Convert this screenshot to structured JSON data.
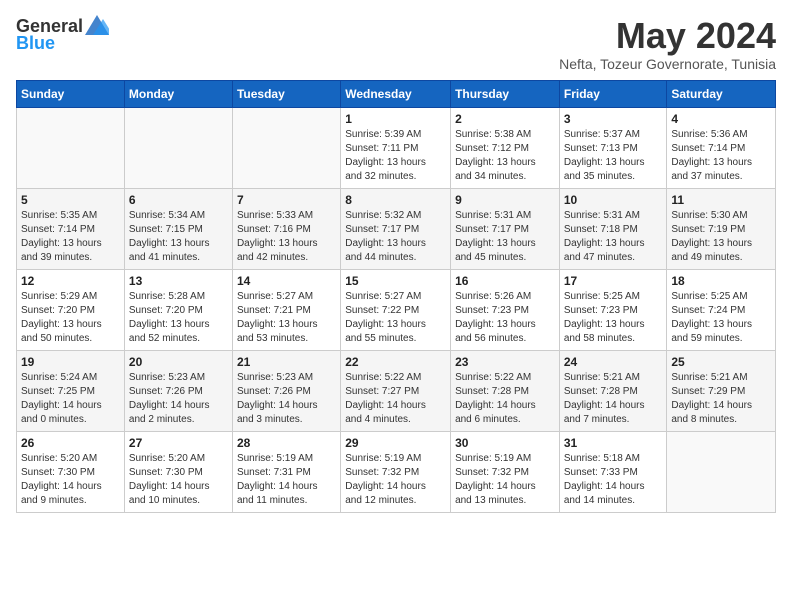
{
  "logo": {
    "general": "General",
    "blue": "Blue"
  },
  "title": {
    "month": "May 2024",
    "location": "Nefta, Tozeur Governorate, Tunisia"
  },
  "weekdays": [
    "Sunday",
    "Monday",
    "Tuesday",
    "Wednesday",
    "Thursday",
    "Friday",
    "Saturday"
  ],
  "weeks": [
    [
      {
        "day": "",
        "info": ""
      },
      {
        "day": "",
        "info": ""
      },
      {
        "day": "",
        "info": ""
      },
      {
        "day": "1",
        "info": "Sunrise: 5:39 AM\nSunset: 7:11 PM\nDaylight: 13 hours\nand 32 minutes."
      },
      {
        "day": "2",
        "info": "Sunrise: 5:38 AM\nSunset: 7:12 PM\nDaylight: 13 hours\nand 34 minutes."
      },
      {
        "day": "3",
        "info": "Sunrise: 5:37 AM\nSunset: 7:13 PM\nDaylight: 13 hours\nand 35 minutes."
      },
      {
        "day": "4",
        "info": "Sunrise: 5:36 AM\nSunset: 7:14 PM\nDaylight: 13 hours\nand 37 minutes."
      }
    ],
    [
      {
        "day": "5",
        "info": "Sunrise: 5:35 AM\nSunset: 7:14 PM\nDaylight: 13 hours\nand 39 minutes."
      },
      {
        "day": "6",
        "info": "Sunrise: 5:34 AM\nSunset: 7:15 PM\nDaylight: 13 hours\nand 41 minutes."
      },
      {
        "day": "7",
        "info": "Sunrise: 5:33 AM\nSunset: 7:16 PM\nDaylight: 13 hours\nand 42 minutes."
      },
      {
        "day": "8",
        "info": "Sunrise: 5:32 AM\nSunset: 7:17 PM\nDaylight: 13 hours\nand 44 minutes."
      },
      {
        "day": "9",
        "info": "Sunrise: 5:31 AM\nSunset: 7:17 PM\nDaylight: 13 hours\nand 45 minutes."
      },
      {
        "day": "10",
        "info": "Sunrise: 5:31 AM\nSunset: 7:18 PM\nDaylight: 13 hours\nand 47 minutes."
      },
      {
        "day": "11",
        "info": "Sunrise: 5:30 AM\nSunset: 7:19 PM\nDaylight: 13 hours\nand 49 minutes."
      }
    ],
    [
      {
        "day": "12",
        "info": "Sunrise: 5:29 AM\nSunset: 7:20 PM\nDaylight: 13 hours\nand 50 minutes."
      },
      {
        "day": "13",
        "info": "Sunrise: 5:28 AM\nSunset: 7:20 PM\nDaylight: 13 hours\nand 52 minutes."
      },
      {
        "day": "14",
        "info": "Sunrise: 5:27 AM\nSunset: 7:21 PM\nDaylight: 13 hours\nand 53 minutes."
      },
      {
        "day": "15",
        "info": "Sunrise: 5:27 AM\nSunset: 7:22 PM\nDaylight: 13 hours\nand 55 minutes."
      },
      {
        "day": "16",
        "info": "Sunrise: 5:26 AM\nSunset: 7:23 PM\nDaylight: 13 hours\nand 56 minutes."
      },
      {
        "day": "17",
        "info": "Sunrise: 5:25 AM\nSunset: 7:23 PM\nDaylight: 13 hours\nand 58 minutes."
      },
      {
        "day": "18",
        "info": "Sunrise: 5:25 AM\nSunset: 7:24 PM\nDaylight: 13 hours\nand 59 minutes."
      }
    ],
    [
      {
        "day": "19",
        "info": "Sunrise: 5:24 AM\nSunset: 7:25 PM\nDaylight: 14 hours\nand 0 minutes."
      },
      {
        "day": "20",
        "info": "Sunrise: 5:23 AM\nSunset: 7:26 PM\nDaylight: 14 hours\nand 2 minutes."
      },
      {
        "day": "21",
        "info": "Sunrise: 5:23 AM\nSunset: 7:26 PM\nDaylight: 14 hours\nand 3 minutes."
      },
      {
        "day": "22",
        "info": "Sunrise: 5:22 AM\nSunset: 7:27 PM\nDaylight: 14 hours\nand 4 minutes."
      },
      {
        "day": "23",
        "info": "Sunrise: 5:22 AM\nSunset: 7:28 PM\nDaylight: 14 hours\nand 6 minutes."
      },
      {
        "day": "24",
        "info": "Sunrise: 5:21 AM\nSunset: 7:28 PM\nDaylight: 14 hours\nand 7 minutes."
      },
      {
        "day": "25",
        "info": "Sunrise: 5:21 AM\nSunset: 7:29 PM\nDaylight: 14 hours\nand 8 minutes."
      }
    ],
    [
      {
        "day": "26",
        "info": "Sunrise: 5:20 AM\nSunset: 7:30 PM\nDaylight: 14 hours\nand 9 minutes."
      },
      {
        "day": "27",
        "info": "Sunrise: 5:20 AM\nSunset: 7:30 PM\nDaylight: 14 hours\nand 10 minutes."
      },
      {
        "day": "28",
        "info": "Sunrise: 5:19 AM\nSunset: 7:31 PM\nDaylight: 14 hours\nand 11 minutes."
      },
      {
        "day": "29",
        "info": "Sunrise: 5:19 AM\nSunset: 7:32 PM\nDaylight: 14 hours\nand 12 minutes."
      },
      {
        "day": "30",
        "info": "Sunrise: 5:19 AM\nSunset: 7:32 PM\nDaylight: 14 hours\nand 13 minutes."
      },
      {
        "day": "31",
        "info": "Sunrise: 5:18 AM\nSunset: 7:33 PM\nDaylight: 14 hours\nand 14 minutes."
      },
      {
        "day": "",
        "info": ""
      }
    ]
  ]
}
